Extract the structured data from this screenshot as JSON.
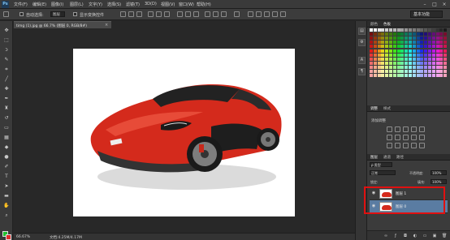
{
  "app": {
    "logo": "Ps"
  },
  "menu": [
    "文件(F)",
    "编辑(E)",
    "图像(I)",
    "图层(L)",
    "文字(Y)",
    "选择(S)",
    "滤镜(T)",
    "3D(D)",
    "视图(V)",
    "窗口(W)",
    "帮助(H)"
  ],
  "window_controls": [
    "–",
    "□",
    "×"
  ],
  "options": {
    "auto_select_label": "自动选择:",
    "auto_select_value": "图层",
    "show_transform_label": "显示变换控件",
    "workspace": "基本功能"
  },
  "document": {
    "tab_label": "timg (1).jpg @ 66.7% (图层 0, RGB/8#)",
    "close_glyph": "×",
    "zoom": "66.67%",
    "doc_info": "文档:4.25M/4.17M"
  },
  "colors": {
    "foreground": "#21c130",
    "background": "#e22a2a",
    "highlight": "#e01010",
    "car_red": "#d42a1c"
  },
  "panels": {
    "swatches_tabs": [
      "颜色",
      "色板"
    ],
    "adjustments_tabs": [
      "调整",
      "样式"
    ],
    "adjustments_title": "添加调整",
    "layers_tabs": [
      "图层",
      "通道",
      "路径"
    ],
    "kind_filter": "ρ 类型",
    "blend_mode": "正常",
    "opacity_label": "不透明度:",
    "opacity_value": "100%",
    "lock_label": "锁定:",
    "fill_label": "填充:",
    "fill_value": "100%",
    "layers": [
      {
        "name": "图层 1",
        "visible": true,
        "selected": false
      },
      {
        "name": "图层 0",
        "visible": true,
        "selected": true
      }
    ]
  },
  "icons": {
    "tools": [
      "move-tool-icon",
      "marquee-tool-icon",
      "lasso-tool-icon",
      "quick-select-tool-icon",
      "crop-tool-icon",
      "eyedropper-tool-icon",
      "healing-brush-icon",
      "brush-tool-icon",
      "clone-stamp-icon",
      "history-brush-icon",
      "eraser-tool-icon",
      "gradient-tool-icon",
      "blur-tool-icon",
      "dodge-tool-icon",
      "pen-tool-icon",
      "type-tool-icon",
      "path-select-icon",
      "shape-tool-icon",
      "hand-tool-icon",
      "zoom-tool-icon"
    ]
  }
}
